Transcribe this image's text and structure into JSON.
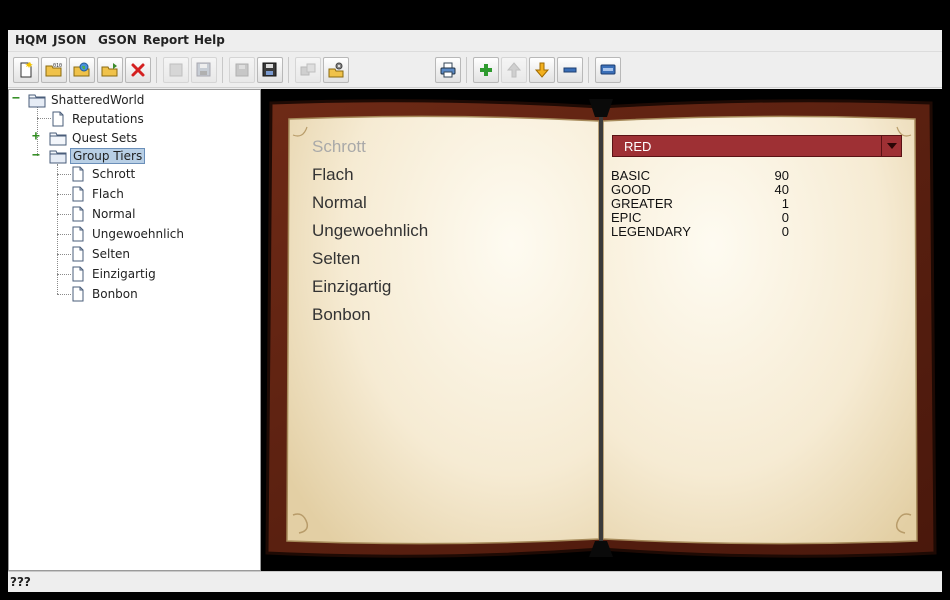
{
  "menubar": {
    "items": [
      "HQM",
      "JSON",
      "GSON",
      "Report",
      "Help"
    ]
  },
  "toolbar": {
    "buttons": [
      {
        "name": "new-file-icon",
        "enabled": true
      },
      {
        "name": "open-folder-icon",
        "enabled": true
      },
      {
        "name": "open-world-icon",
        "enabled": true
      },
      {
        "name": "open-recent-icon",
        "enabled": true
      },
      {
        "name": "delete-icon",
        "enabled": true
      },
      {
        "name": "blank-icon",
        "enabled": false
      },
      {
        "name": "save-as-icon",
        "enabled": false
      },
      {
        "name": "save-disabled-icon",
        "enabled": false
      },
      {
        "name": "save-all-icon",
        "enabled": true
      },
      {
        "name": "copy-disabled-icon",
        "enabled": false
      },
      {
        "name": "settings-icon",
        "enabled": true
      },
      {
        "name": "print-icon",
        "enabled": true
      },
      {
        "name": "add-icon",
        "enabled": true
      },
      {
        "name": "move-up-icon",
        "enabled": false
      },
      {
        "name": "move-down-icon",
        "enabled": true
      },
      {
        "name": "remove-icon",
        "enabled": true
      },
      {
        "name": "window-icon",
        "enabled": true
      }
    ]
  },
  "tree": {
    "root": "ShatteredWorld",
    "reputations": "Reputations",
    "quest_sets": "Quest Sets",
    "group_tiers": "Group Tiers",
    "tiers": [
      "Schrott",
      "Flach",
      "Normal",
      "Ungewoehnlich",
      "Selten",
      "Einzigartig",
      "Bonbon"
    ]
  },
  "book": {
    "tier_list": [
      "Schrott",
      "Flach",
      "Normal",
      "Ungewoehnlich",
      "Selten",
      "Einzigartig",
      "Bonbon"
    ],
    "selected_tier_index": 0,
    "color_select": {
      "value": "RED",
      "color": "#9e3034"
    },
    "stats": [
      {
        "label": "BASIC",
        "value": "90"
      },
      {
        "label": "GOOD",
        "value": "40"
      },
      {
        "label": "GREATER",
        "value": "1"
      },
      {
        "label": "EPIC",
        "value": "0"
      },
      {
        "label": "LEGENDARY",
        "value": "0"
      }
    ]
  },
  "status": {
    "text": "???"
  }
}
